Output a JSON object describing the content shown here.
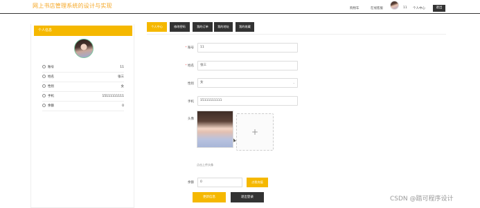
{
  "header": {
    "site_title": "网上书店管理系统的设计与实现",
    "nav": [
      "购物车",
      "在线客服"
    ],
    "username": "11",
    "user_center": "个人中心",
    "logout": "退出"
  },
  "sidebar": {
    "title": "个人信息",
    "rows": [
      {
        "label": "账号",
        "value": "11"
      },
      {
        "label": "姓名",
        "value": "张三"
      },
      {
        "label": "性别",
        "value": "女"
      },
      {
        "label": "手机",
        "value": "15111111111"
      },
      {
        "label": "余额",
        "value": "0"
      }
    ]
  },
  "tabs": [
    "个人中心",
    "修改密码",
    "我的订单",
    "我的地址",
    "我的收藏"
  ],
  "form": {
    "account_label": "账号",
    "account_value": "11",
    "name_label": "姓名",
    "name_value": "张三",
    "gender_label": "性别",
    "gender_value": "女",
    "phone_label": "手机",
    "phone_value": "15111111111",
    "avatar_label": "头像",
    "upload_hint": "点击上传头像",
    "balance_label": "余额",
    "balance_value": "0",
    "recharge_button": "点我充值",
    "update_button": "更新信息",
    "logout_button": "退出登录"
  },
  "watermark": "CSDN @踏可程序设计",
  "colors": {
    "accent": "#f5b800",
    "dark": "#333333"
  }
}
